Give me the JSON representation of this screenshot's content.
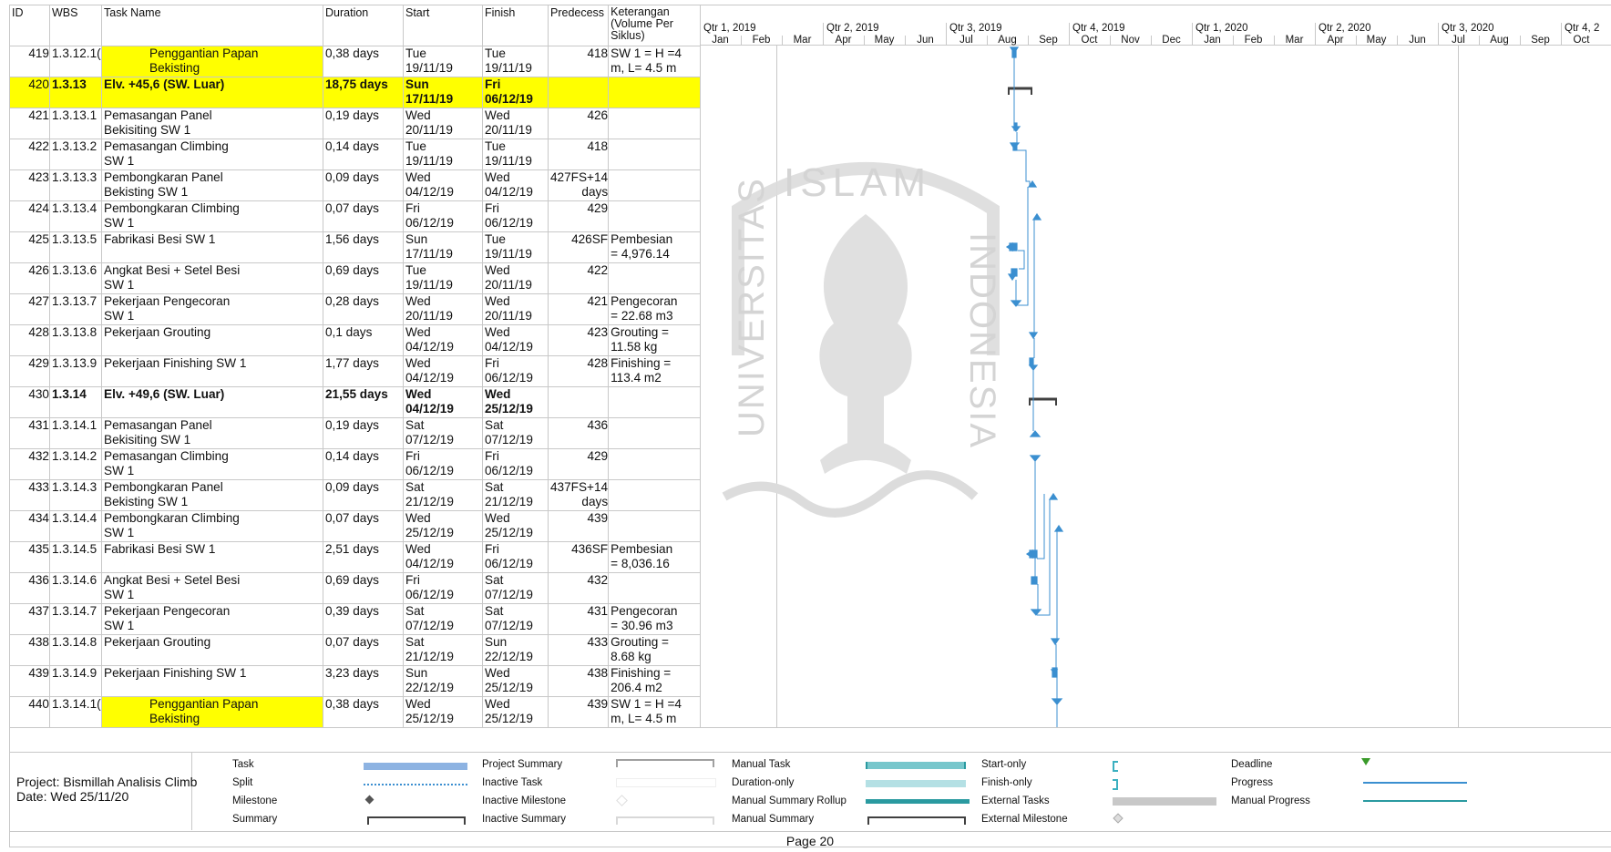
{
  "columns": {
    "id": "ID",
    "wbs": "WBS",
    "name": "Task Name",
    "duration": "Duration",
    "start": "Start",
    "finish": "Finish",
    "pred": "Predecess",
    "ket1": "Keterangan",
    "ket2": "(Volume Per",
    "ket3": "Siklus)"
  },
  "rows": [
    {
      "id": "419",
      "wbs": "1.3.12.1(",
      "name1": "Penggantian Papan",
      "name2": "Bekisting",
      "dur": "0,38 days",
      "start1": "Tue",
      "start2": "19/11/19",
      "fin1": "Tue",
      "fin2": "19/11/19",
      "pred1": "418",
      "pred2": "",
      "ket1": "SW 1 = H =4",
      "ket2": "m, L= 4.5 m"
    },
    {
      "id": "420",
      "wbs": "1.3.13",
      "name1": "Elv. +45,6 (SW. Luar)",
      "name2": "",
      "dur": "18,75 days",
      "start1": "Sun",
      "start2": "17/11/19",
      "fin1": "Fri",
      "fin2": "06/12/19",
      "pred1": "",
      "pred2": "",
      "ket1": "",
      "ket2": ""
    },
    {
      "id": "421",
      "wbs": "1.3.13.1",
      "name1": "Pemasangan Panel",
      "name2": "Bekisiting SW 1",
      "dur": "0,19 days",
      "start1": "Wed",
      "start2": "20/11/19",
      "fin1": "Wed",
      "fin2": "20/11/19",
      "pred1": "426",
      "pred2": "",
      "ket1": "",
      "ket2": ""
    },
    {
      "id": "422",
      "wbs": "1.3.13.2",
      "name1": "Pemasangan Climbing",
      "name2": "SW 1",
      "dur": "0,14 days",
      "start1": "Tue",
      "start2": "19/11/19",
      "fin1": "Tue",
      "fin2": "19/11/19",
      "pred1": "418",
      "pred2": "",
      "ket1": "",
      "ket2": ""
    },
    {
      "id": "423",
      "wbs": "1.3.13.3",
      "name1": "Pembongkaran Panel",
      "name2": "Bekisting SW 1",
      "dur": "0,09 days",
      "start1": "Wed",
      "start2": "04/12/19",
      "fin1": "Wed",
      "fin2": "04/12/19",
      "pred1": "427FS+14",
      "pred2": "days",
      "ket1": "",
      "ket2": ""
    },
    {
      "id": "424",
      "wbs": "1.3.13.4",
      "name1": "Pembongkaran Climbing",
      "name2": "SW 1",
      "dur": "0,07 days",
      "start1": "Fri",
      "start2": "06/12/19",
      "fin1": "Fri",
      "fin2": "06/12/19",
      "pred1": "429",
      "pred2": "",
      "ket1": "",
      "ket2": ""
    },
    {
      "id": "425",
      "wbs": "1.3.13.5",
      "name1": "Fabrikasi Besi SW 1",
      "name2": "",
      "dur": "1,56 days",
      "start1": "Sun",
      "start2": "17/11/19",
      "fin1": "Tue",
      "fin2": "19/11/19",
      "pred1": "426SF",
      "pred2": "",
      "ket1": "Pembesian",
      "ket2": "= 4,976.14"
    },
    {
      "id": "426",
      "wbs": "1.3.13.6",
      "name1": "Angkat Besi + Setel Besi",
      "name2": "SW 1",
      "dur": "0,69 days",
      "start1": "Tue",
      "start2": "19/11/19",
      "fin1": "Wed",
      "fin2": "20/11/19",
      "pred1": "422",
      "pred2": "",
      "ket1": "",
      "ket2": ""
    },
    {
      "id": "427",
      "wbs": "1.3.13.7",
      "name1": "Pekerjaan Pengecoran",
      "name2": "SW 1",
      "dur": "0,28 days",
      "start1": "Wed",
      "start2": "20/11/19",
      "fin1": "Wed",
      "fin2": "20/11/19",
      "pred1": "421",
      "pred2": "",
      "ket1": "Pengecoran",
      "ket2": "= 22.68 m3"
    },
    {
      "id": "428",
      "wbs": "1.3.13.8",
      "name1": "Pekerjaan Grouting",
      "name2": "",
      "dur": "0,1 days",
      "start1": "Wed",
      "start2": "04/12/19",
      "fin1": "Wed",
      "fin2": "04/12/19",
      "pred1": "423",
      "pred2": "",
      "ket1": "Grouting =",
      "ket2": "11.58 kg"
    },
    {
      "id": "429",
      "wbs": "1.3.13.9",
      "name1": "Pekerjaan Finishing SW 1",
      "name2": "",
      "dur": "1,77 days",
      "start1": "Wed",
      "start2": "04/12/19",
      "fin1": "Fri",
      "fin2": "06/12/19",
      "pred1": "428",
      "pred2": "",
      "ket1": "Finishing =",
      "ket2": "113.4 m2"
    },
    {
      "id": "430",
      "wbs": "1.3.14",
      "name1": "Elv. +49,6 (SW. Luar)",
      "name2": "",
      "dur": "21,55 days",
      "start1": "Wed",
      "start2": "04/12/19",
      "fin1": "Wed",
      "fin2": "25/12/19",
      "pred1": "",
      "pred2": "",
      "ket1": "",
      "ket2": ""
    },
    {
      "id": "431",
      "wbs": "1.3.14.1",
      "name1": "Pemasangan Panel",
      "name2": "Bekisiting SW 1",
      "dur": "0,19 days",
      "start1": "Sat",
      "start2": "07/12/19",
      "fin1": "Sat",
      "fin2": "07/12/19",
      "pred1": "436",
      "pred2": "",
      "ket1": "",
      "ket2": ""
    },
    {
      "id": "432",
      "wbs": "1.3.14.2",
      "name1": "Pemasangan Climbing",
      "name2": "SW 1",
      "dur": "0,14 days",
      "start1": "Fri",
      "start2": "06/12/19",
      "fin1": "Fri",
      "fin2": "06/12/19",
      "pred1": "429",
      "pred2": "",
      "ket1": "",
      "ket2": ""
    },
    {
      "id": "433",
      "wbs": "1.3.14.3",
      "name1": "Pembongkaran Panel",
      "name2": "Bekisting SW 1",
      "dur": "0,09 days",
      "start1": "Sat",
      "start2": "21/12/19",
      "fin1": "Sat",
      "fin2": "21/12/19",
      "pred1": "437FS+14",
      "pred2": "days",
      "ket1": "",
      "ket2": ""
    },
    {
      "id": "434",
      "wbs": "1.3.14.4",
      "name1": "Pembongkaran Climbing",
      "name2": "SW 1",
      "dur": "0,07 days",
      "start1": "Wed",
      "start2": "25/12/19",
      "fin1": "Wed",
      "fin2": "25/12/19",
      "pred1": "439",
      "pred2": "",
      "ket1": "",
      "ket2": ""
    },
    {
      "id": "435",
      "wbs": "1.3.14.5",
      "name1": "Fabrikasi Besi SW 1",
      "name2": "",
      "dur": "2,51 days",
      "start1": "Wed",
      "start2": "04/12/19",
      "fin1": "Fri",
      "fin2": "06/12/19",
      "pred1": "436SF",
      "pred2": "",
      "ket1": "Pembesian",
      "ket2": "= 8,036.16"
    },
    {
      "id": "436",
      "wbs": "1.3.14.6",
      "name1": "Angkat Besi + Setel Besi",
      "name2": "SW 1",
      "dur": "0,69 days",
      "start1": "Fri",
      "start2": "06/12/19",
      "fin1": "Sat",
      "fin2": "07/12/19",
      "pred1": "432",
      "pred2": "",
      "ket1": "",
      "ket2": ""
    },
    {
      "id": "437",
      "wbs": "1.3.14.7",
      "name1": "Pekerjaan Pengecoran",
      "name2": "SW 1",
      "dur": "0,39 days",
      "start1": "Sat",
      "start2": "07/12/19",
      "fin1": "Sat",
      "fin2": "07/12/19",
      "pred1": "431",
      "pred2": "",
      "ket1": "Pengecoran",
      "ket2": "= 30.96 m3"
    },
    {
      "id": "438",
      "wbs": "1.3.14.8",
      "name1": "Pekerjaan Grouting",
      "name2": "",
      "dur": "0,07 days",
      "start1": "Sat",
      "start2": "21/12/19",
      "fin1": "Sun",
      "fin2": "22/12/19",
      "pred1": "433",
      "pred2": "",
      "ket1": "Grouting =",
      "ket2": "8.68 kg"
    },
    {
      "id": "439",
      "wbs": "1.3.14.9",
      "name1": "Pekerjaan Finishing SW 1",
      "name2": "",
      "dur": "3,23 days",
      "start1": "Sun",
      "start2": "22/12/19",
      "fin1": "Wed",
      "fin2": "25/12/19",
      "pred1": "438",
      "pred2": "",
      "ket1": "Finishing =",
      "ket2": "206.4 m2"
    },
    {
      "id": "440",
      "wbs": "1.3.14.1(",
      "name1": "Penggantian Papan",
      "name2": "Bekisting",
      "dur": "0,38 days",
      "start1": "Wed",
      "start2": "25/12/19",
      "fin1": "Wed",
      "fin2": "25/12/19",
      "pred1": "439",
      "pred2": "",
      "ket1": "SW 1 = H =4",
      "ket2": "m, L= 4.5 m"
    }
  ],
  "timeline": {
    "quarters": [
      "Qtr 1, 2019",
      "Qtr 2, 2019",
      "Qtr 3, 2019",
      "Qtr 4, 2019",
      "Qtr 1, 2020",
      "Qtr 2, 2020",
      "Qtr 3, 2020",
      "Qtr 4, 2"
    ],
    "months": [
      "Jan",
      "Feb",
      "Mar",
      "Apr",
      "May",
      "Jun",
      "Jul",
      "Aug",
      "Sep",
      "Oct",
      "Nov",
      "Dec",
      "Jan",
      "Feb",
      "Mar",
      "Apr",
      "May",
      "Jun",
      "Jul",
      "Aug",
      "Sep",
      "Oct"
    ]
  },
  "watermark": {
    "top_text": "ISLAM",
    "left_text": "UNIVERSITAS",
    "right_text": "INDONESIA"
  },
  "legend": {
    "project": "Project: Bismillah Analisis Climb",
    "date": "Date: Wed 25/11/20",
    "items": {
      "task": "Task",
      "split": "Split",
      "milestone": "Milestone",
      "summary": "Summary",
      "project_summary": "Project Summary",
      "inactive_task": "Inactive Task",
      "inactive_milestone": "Inactive Milestone",
      "inactive_summary": "Inactive Summary",
      "manual_task": "Manual Task",
      "duration_only": "Duration-only",
      "manual_summary_rollup": "Manual Summary Rollup",
      "manual_summary": "Manual Summary",
      "start_only": "Start-only",
      "finish_only": "Finish-only",
      "external_tasks": "External Tasks",
      "external_milestone": "External Milestone",
      "deadline": "Deadline",
      "progress": "Progress",
      "manual_progress": "Manual Progress"
    }
  },
  "footer": {
    "page": "Page 20"
  },
  "colors": {
    "highlight": "#ffff00",
    "task_bar": "#3b8fd0",
    "grid": "#c8c8c8",
    "summary_bar": "#404040"
  }
}
